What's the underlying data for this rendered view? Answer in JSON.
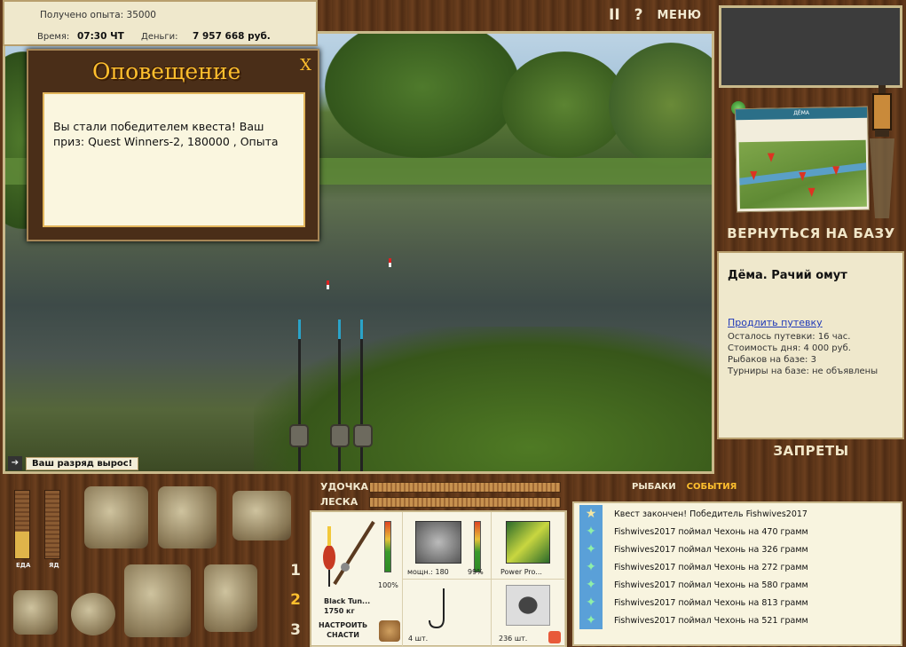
{
  "stats": {
    "exp_text": "Получено опыта: 35000",
    "time_label": "Время:",
    "time_value": "07:30 ЧТ",
    "money_label": "Деньги:",
    "money_value": "7 957 668 руб."
  },
  "controls": {
    "pause": "II",
    "help": "?",
    "menu": "МЕНЮ"
  },
  "notification": {
    "title": "Оповещение",
    "close": "X",
    "text": "Вы стали победителем квеста! Ваш приз: Quest Winners-2, 180000 , Опыта"
  },
  "level_up": "Ваш разряд вырос!",
  "right_panel": {
    "map_header": "ДЁМА",
    "back_to_base": "ВЕРНУТЬСЯ НА БАЗУ",
    "location_name": "Дёма. Рачий омут",
    "extend_pass": "Продлить путевку",
    "pass_left": "Осталось путевки: 16 час.",
    "day_cost": "Стоимость дня: 4 000 руб.",
    "fishers": "Рыбаков на базе: 3",
    "tournaments": "Турниры на базе: не объявлены",
    "bans": "ЗАПРЕТЫ"
  },
  "hud": {
    "food_label": "ЕДА",
    "food_level": 0.4,
    "poison_label": "ЯД",
    "poison_level": 0,
    "rod_label": "УДОЧКА",
    "line_label": "ЛЕСКА",
    "slots": [
      "1",
      "2",
      "3"
    ],
    "active_slot": "2"
  },
  "gear": {
    "rod_name": "Black Tun...",
    "rod_weight": "1750 кг",
    "rod_percent": "100%",
    "reel_power": "мощн.: 180",
    "reel_percent": "99%",
    "line_name": "Power Pro...",
    "hook_count": "4 шт.",
    "bait_count": "236 шт.",
    "setup_label": "НАСТРОИТЬ\nСНАСТИ"
  },
  "events": {
    "tabs": [
      "РЫБАКИ",
      "СОБЫТИЯ"
    ],
    "active_tab": "СОБЫТИЯ",
    "items": [
      {
        "icon": "star-icon",
        "text": "Квест закончен! Победитель Fishwives2017"
      },
      {
        "icon": "fish-icon",
        "text": "Fishwives2017 поймал Чехонь на 470 грамм"
      },
      {
        "icon": "fish-icon",
        "text": "Fishwives2017 поймал Чехонь на 326 грамм"
      },
      {
        "icon": "fish-icon",
        "text": "Fishwives2017 поймал Чехонь на 272 грамм"
      },
      {
        "icon": "fish-icon",
        "text": "Fishwives2017 поймал Чехонь на 580 грамм"
      },
      {
        "icon": "fish-icon",
        "text": "Fishwives2017 поймал Чехонь на 813 грамм"
      },
      {
        "icon": "fish-icon",
        "text": "Fishwives2017 поймал Чехонь на 521 грамм"
      }
    ]
  },
  "colors": {
    "accent": "#ffbf2e",
    "link": "#1f39b8",
    "paper": "#efe8cc"
  }
}
